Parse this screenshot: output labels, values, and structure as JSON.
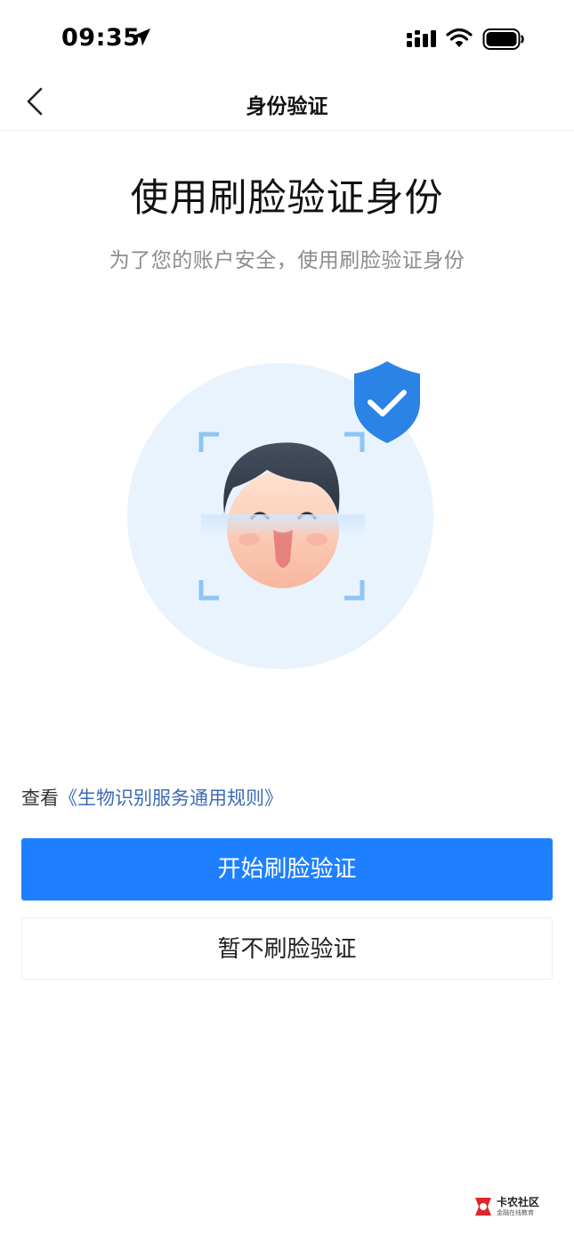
{
  "status_bar": {
    "time": "09:35"
  },
  "nav": {
    "title": "身份验证"
  },
  "main": {
    "title": "使用刷脸验证身份",
    "subtitle": "为了您的账户安全，使用刷脸验证身份"
  },
  "rules": {
    "prefix": "查看",
    "link_text": "《生物识别服务通用规则》"
  },
  "buttons": {
    "primary_label": "开始刷脸验证",
    "secondary_label": "暂不刷脸验证"
  },
  "watermark": {
    "title": "卡农社区",
    "subtitle": "金融在线教育"
  },
  "colors": {
    "primary": "#1e80ff",
    "link": "#3b6bb3",
    "shield": "#2b83e6",
    "circle_bg": "#e8f3fd"
  },
  "icons": [
    "location-arrow-icon",
    "signal-icon",
    "wifi-icon",
    "battery-icon",
    "back-chevron-icon",
    "shield-check-icon",
    "face-icon",
    "scan-frame-icon"
  ]
}
